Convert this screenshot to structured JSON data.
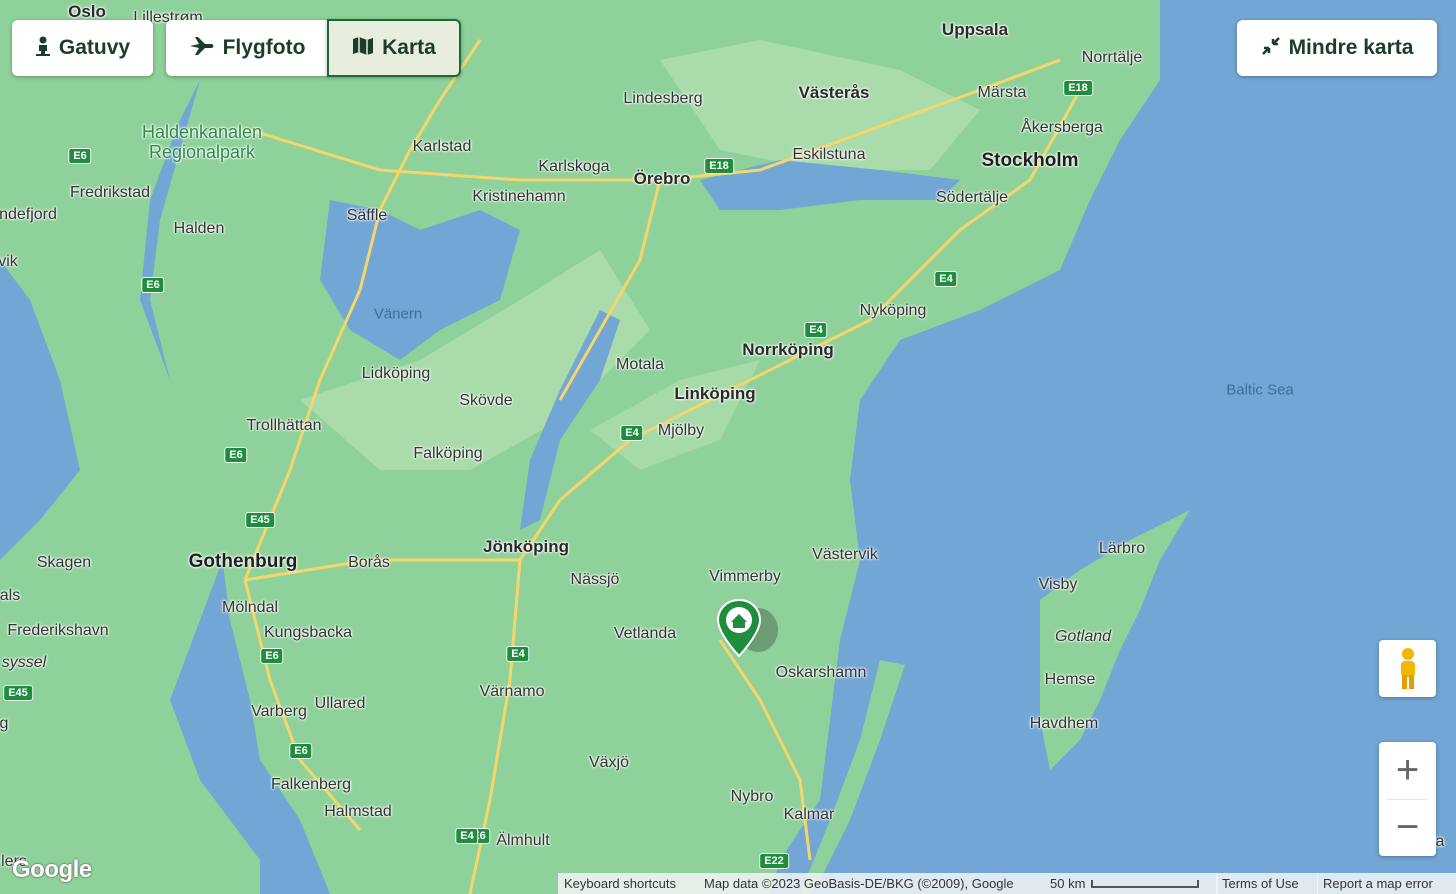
{
  "controls": {
    "street_view": "Gatuvy",
    "aerial": "Flygfoto",
    "map": "Karta",
    "smaller_map": "Mindre karta"
  },
  "map_labels": {
    "cities": [
      {
        "name": "Oslo",
        "cls": "mid"
      },
      {
        "name": "Lillestrøm",
        "cls": ""
      },
      {
        "name": "Uppsala",
        "cls": "mid"
      },
      {
        "name": "Norrtälje",
        "cls": ""
      },
      {
        "name": "Lindesberg",
        "cls": ""
      },
      {
        "name": "Västerås",
        "cls": "mid"
      },
      {
        "name": "Märsta",
        "cls": ""
      },
      {
        "name": "Åkersberga",
        "cls": ""
      },
      {
        "name": "Karlstad",
        "cls": ""
      },
      {
        "name": "Karlskoga",
        "cls": ""
      },
      {
        "name": "Örebro",
        "cls": "mid"
      },
      {
        "name": "Eskilstuna",
        "cls": ""
      },
      {
        "name": "Stockholm",
        "cls": "big"
      },
      {
        "name": "Kristinehamn",
        "cls": ""
      },
      {
        "name": "Södertälje",
        "cls": ""
      },
      {
        "name": "Fredrikstad",
        "cls": ""
      },
      {
        "name": "Säffle",
        "cls": ""
      },
      {
        "name": "ndefjord",
        "cls": ""
      },
      {
        "name": "Halden",
        "cls": ""
      },
      {
        "name": "vik",
        "cls": ""
      },
      {
        "name": "Nyköping",
        "cls": ""
      },
      {
        "name": "Norrköping",
        "cls": "mid"
      },
      {
        "name": "Lidköping",
        "cls": ""
      },
      {
        "name": "Motala",
        "cls": ""
      },
      {
        "name": "Linköping",
        "cls": "mid"
      },
      {
        "name": "Skövde",
        "cls": ""
      },
      {
        "name": "Trollhättan",
        "cls": ""
      },
      {
        "name": "Mjölby",
        "cls": ""
      },
      {
        "name": "Falköping",
        "cls": ""
      },
      {
        "name": "Lärbro",
        "cls": ""
      },
      {
        "name": "Jönköping",
        "cls": "mid"
      },
      {
        "name": "Västervik",
        "cls": ""
      },
      {
        "name": "Skagen",
        "cls": ""
      },
      {
        "name": "Gothenburg",
        "cls": "big"
      },
      {
        "name": "Borås",
        "cls": ""
      },
      {
        "name": "Nässjö",
        "cls": ""
      },
      {
        "name": "Vimmerby",
        "cls": ""
      },
      {
        "name": "Visby",
        "cls": ""
      },
      {
        "name": "als",
        "cls": ""
      },
      {
        "name": "Mölndal",
        "cls": ""
      },
      {
        "name": "Frederikshavn",
        "cls": ""
      },
      {
        "name": "Kungsbacka",
        "cls": ""
      },
      {
        "name": "Vetlanda",
        "cls": ""
      },
      {
        "name": "syssel",
        "cls": "island"
      },
      {
        "name": "Oskarshamn",
        "cls": ""
      },
      {
        "name": "Hemse",
        "cls": ""
      },
      {
        "name": "Värnamo",
        "cls": ""
      },
      {
        "name": "Ullared",
        "cls": ""
      },
      {
        "name": "Varberg",
        "cls": ""
      },
      {
        "name": "Havdhem",
        "cls": ""
      },
      {
        "name": "Växjö",
        "cls": ""
      },
      {
        "name": "Falkenberg",
        "cls": ""
      },
      {
        "name": "Nybro",
        "cls": ""
      },
      {
        "name": "Halmstad",
        "cls": ""
      },
      {
        "name": "Kalmar",
        "cls": ""
      },
      {
        "name": "Älmhult",
        "cls": ""
      },
      {
        "name": "lers",
        "cls": ""
      },
      {
        "name": "a",
        "cls": ""
      },
      {
        "name": "g",
        "cls": ""
      }
    ],
    "water": [
      {
        "name": "Vänern"
      },
      {
        "name": "Baltic Sea"
      }
    ],
    "park": "Haldenkanalen\nRegionalpark",
    "island": "Gotland"
  },
  "road_shields": [
    "E6",
    "E6",
    "E6",
    "E6",
    "E6",
    "E6",
    "E18",
    "E18",
    "E4",
    "E4",
    "E4",
    "E4",
    "E4",
    "E45",
    "E45",
    "E22"
  ],
  "footer": {
    "google": "Google",
    "keyboard": "Keyboard shortcuts",
    "map_data": "Map data ©2023 GeoBasis-DE/BKG (©2009), Google",
    "scale": "50 km",
    "terms": "Terms of Use",
    "report": "Report a map error"
  },
  "colors": {
    "land": "#8fd19a",
    "land_light": "#b5e0b2",
    "water": "#72a6d4",
    "road": "#f5d66b",
    "marker": "#1e8e3e",
    "active_button_border": "#1a6b3a"
  },
  "icons": {
    "street_view": "person-icon",
    "aerial": "airplane-icon",
    "map": "map-icon",
    "smaller_map": "collapse-icon",
    "pegman": "pegman-icon",
    "marker": "home-marker-icon"
  }
}
